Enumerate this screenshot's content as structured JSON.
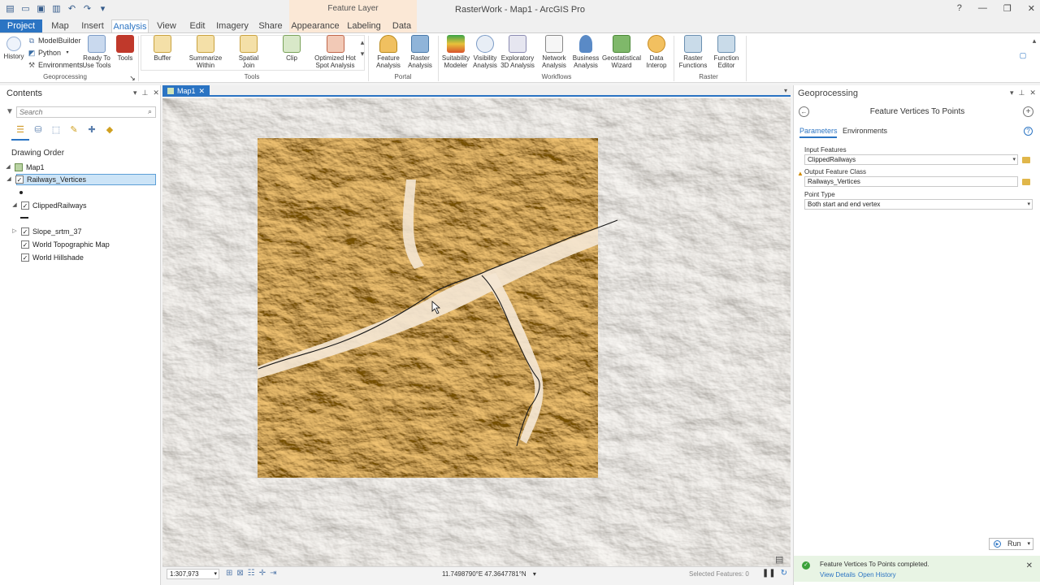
{
  "window": {
    "title": "RasterWork - Map1 - ArcGIS Pro",
    "context_group": "Feature Layer",
    "help": "?",
    "minimize": "—",
    "restore": "❐",
    "close": "✕"
  },
  "tabs": [
    {
      "label": "Project"
    },
    {
      "label": "Map"
    },
    {
      "label": "Insert"
    },
    {
      "label": "Analysis"
    },
    {
      "label": "View"
    },
    {
      "label": "Edit"
    },
    {
      "label": "Imagery"
    },
    {
      "label": "Share"
    },
    {
      "label": "Appearance"
    },
    {
      "label": "Labeling"
    },
    {
      "label": "Data"
    }
  ],
  "ribbon": {
    "geoprocessing": {
      "history": "History",
      "modelbuilder": "ModelBuilder",
      "python": "Python",
      "environments": "Environments",
      "ready_to_use": "Ready To Use Tools",
      "tools": "Tools",
      "group_label": "Geoprocessing"
    },
    "tools": {
      "buffer": "Buffer",
      "summarize_within": "Summarize Within",
      "spatial_join": "Spatial Join",
      "clip": "Clip",
      "hot_spot": "Optimized Hot Spot Analysis",
      "group_label": "Tools"
    },
    "portal": {
      "feature_analysis": "Feature Analysis",
      "raster_analysis": "Raster Analysis",
      "group_label": "Portal"
    },
    "workflows": {
      "suitability": "Suitability Modeler",
      "visibility": "Visibility Analysis",
      "exploratory": "Exploratory 3D Analysis",
      "network": "Network Analysis",
      "business": "Business Analysis",
      "geostatistical": "Geostatistical Wizard",
      "data_interop": "Data Interop",
      "group_label": "Workflows"
    },
    "raster": {
      "raster_functions": "Raster Functions",
      "function_editor": "Function Editor",
      "group_label": "Raster"
    }
  },
  "contents": {
    "title": "Contents",
    "search_placeholder": "Search",
    "drawing_order": "Drawing Order",
    "layers": {
      "map": "Map1",
      "railways_vertices": "Railways_Vertices",
      "clipped_railways": "ClippedRailways",
      "slope": "Slope_srtm_37",
      "topo": "World Topographic Map",
      "hillshade": "World Hillshade"
    }
  },
  "map": {
    "tab_label": "Map1",
    "scale": "1:307,973",
    "coordinates": "11.7498790°E 47.3647781°N",
    "selected_features": "Selected Features: 0"
  },
  "geoprocessing": {
    "title": "Geoprocessing",
    "tool_title": "Feature Vertices To Points",
    "tab_parameters": "Parameters",
    "tab_environments": "Environments",
    "input_features_label": "Input Features",
    "input_features_value": "ClippedRailways",
    "output_class_label": "Output Feature Class",
    "output_class_value": "Railways_Vertices",
    "point_type_label": "Point Type",
    "point_type_value": "Both start and end vertex",
    "run_label": "Run",
    "notify_message": "Feature Vertices To Points completed.",
    "view_details": "View Details",
    "open_history": "Open History"
  },
  "colors": {
    "accent": "#2b74c3",
    "slope_dark": "#6b3f12",
    "slope_light": "#f3e3cc",
    "hillshade": "#e4e0da"
  }
}
